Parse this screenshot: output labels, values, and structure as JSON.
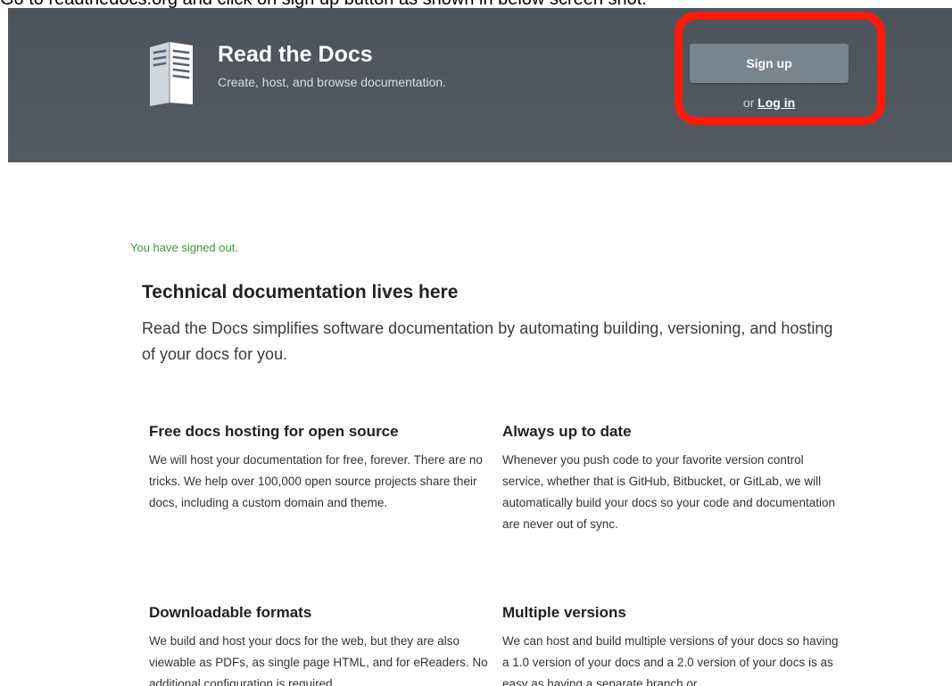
{
  "instruction": {
    "text": "Go to readthedocs.org and click on sign up button as shown in below screen shot."
  },
  "header": {
    "title": "Read the Docs",
    "tagline": "Create, host, and browse documentation.",
    "logo_icon": "book-document-icon",
    "signup_label": "Sign up",
    "login_prefix": "or",
    "login_label": "Log in",
    "highlight_color": "#ff1a0a",
    "background_color": "#50575f"
  },
  "main": {
    "flash_message": "You have signed out.",
    "heading": "Technical documentation lives here",
    "lead": "Read the Docs simplifies software documentation by automating building, versioning, and hosting of your docs for you.",
    "features": [
      {
        "title": "Free docs hosting for open source",
        "body": "We will host your documentation for free, forever. There are no tricks. We help over 100,000 open source projects share their docs, including a custom domain and theme."
      },
      {
        "title": "Always up to date",
        "body": "Whenever you push code to your favorite version control service, whether that is GitHub, Bitbucket, or GitLab, we will automatically build your docs so your code and documentation are never out of sync."
      },
      {
        "title": "Downloadable formats",
        "body": "We build and host your docs for the web, but they are also viewable as PDFs, as single page HTML, and for eReaders. No additional configuration is required."
      },
      {
        "title": "Multiple versions",
        "body": "We can host and build multiple versions of your docs so having a 1.0 version of your docs and a 2.0 version of your docs is as easy as having a separate branch or"
      }
    ]
  }
}
